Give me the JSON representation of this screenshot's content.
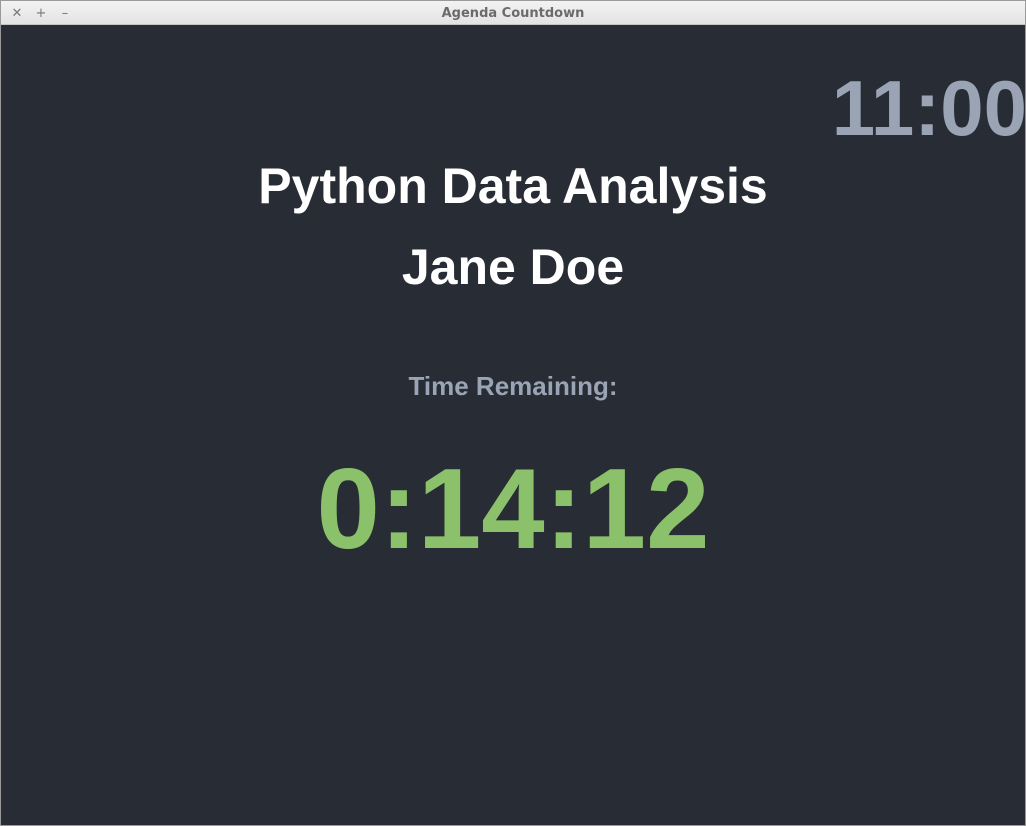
{
  "window": {
    "title": "Agenda Countdown",
    "controls": {
      "close": "✕",
      "maximize": "+",
      "minimize": "–"
    }
  },
  "clock": {
    "time": "11:00"
  },
  "session": {
    "title": "Python Data Analysis",
    "presenter": "Jane Doe"
  },
  "timer": {
    "label": "Time Remaining:",
    "remaining": "0:14:12"
  },
  "colors": {
    "background": "#282c34",
    "clock": "#9aa4b5",
    "countdown": "#8bc16a",
    "title_text": "#ffffff"
  }
}
